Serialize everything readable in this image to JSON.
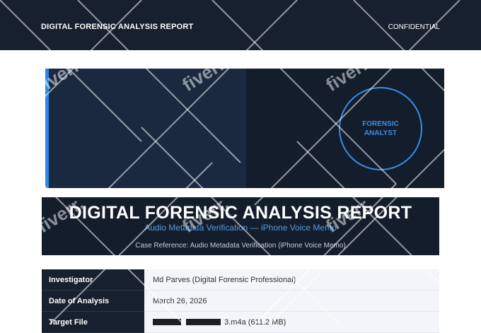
{
  "header": {
    "title": "DIGITAL FORENSIC ANALYSIS REPORT",
    "classification": "CONFIDENTIAL"
  },
  "hero": {
    "badge_text": "FORENSIC\nANALYST"
  },
  "banner": {
    "title": "DIGITAL FORENSIC ANALYSIS REPORT",
    "subtitle": "Audio Metadata Verification — iPhone Voice Memo",
    "case_reference": "Case Reference: Audio Metadata Verification (iPhone Voice Memo)"
  },
  "details": [
    {
      "label": "Investigator",
      "value": "Md Parves (Digital Forensic Professional)"
    },
    {
      "label": "Date of Analysis",
      "value": "March 26, 2026"
    },
    {
      "label": "Target File",
      "value": "3.m4a  (611.2 MB)"
    }
  ],
  "watermark": {
    "text": "fiverr."
  },
  "colors": {
    "header_bg": "#17202e",
    "accent": "#2d86e0",
    "subtitle": "#5a9be6"
  }
}
